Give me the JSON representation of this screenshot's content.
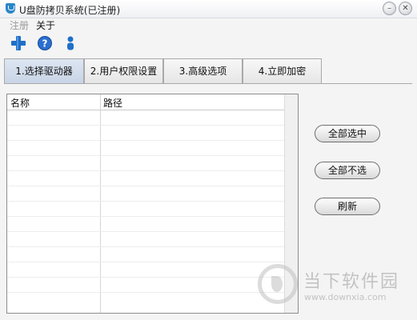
{
  "window": {
    "title": "U盘防拷贝系统(已注册)",
    "minimize_glyph": "–",
    "close_glyph": "✕"
  },
  "menu": {
    "items": [
      {
        "label": "注册",
        "disabled": true
      },
      {
        "label": "关于",
        "disabled": false
      }
    ]
  },
  "toolbar": {
    "icons": [
      "add-icon",
      "help-icon",
      "user-icon"
    ]
  },
  "tabs": [
    {
      "label": "1.选择驱动器",
      "active": true
    },
    {
      "label": "2.用户权限设置",
      "active": false
    },
    {
      "label": "3.高级选项",
      "active": false
    },
    {
      "label": "4.立即加密",
      "active": false
    }
  ],
  "list": {
    "columns": [
      "名称",
      "路径"
    ],
    "rows": []
  },
  "buttons": {
    "select_all": "全部选中",
    "select_none": "全部不选",
    "refresh": "刷新"
  },
  "watermark": {
    "text_cn": "当下软件园",
    "text_en": "www.downxia.com"
  },
  "colors": {
    "active_tab": "#c8d4e6",
    "app_icon": "#2a86c8",
    "toolbar_blue": "#1f6fc8"
  }
}
